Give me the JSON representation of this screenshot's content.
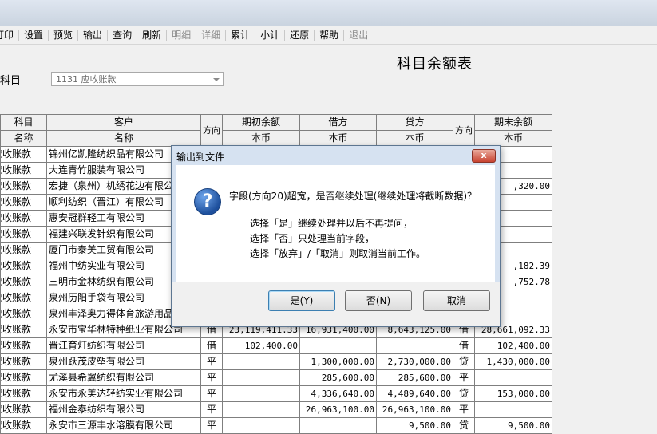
{
  "menu": [
    "打印",
    "设置",
    "预览",
    "输出",
    "查询",
    "刷新",
    "明细",
    "详细",
    "累计",
    "小计",
    "还原",
    "帮助",
    "退出"
  ],
  "menu_disabled": [
    "明细",
    "详细",
    "退出"
  ],
  "report_title": "科目余额表",
  "field_label": "科目",
  "combo_value": "1131 应收账款",
  "headers": {
    "row1": {
      "subject": "科目",
      "customer": "客户",
      "dir1": "方向",
      "opening": "期初余额",
      "debit": "借方",
      "credit": "贷方",
      "dir2": "方向",
      "closing": "期末余额"
    },
    "row2": {
      "subject": "名称",
      "customer": "名称",
      "opening": "本币",
      "debit": "本币",
      "credit": "本币",
      "closing": "本币"
    }
  },
  "rows": [
    [
      "应收账款",
      "锦州亿凯隆纺织品有限公司",
      "",
      "",
      "",
      "",
      "",
      ""
    ],
    [
      "应收账款",
      "大连青竹服装有限公司",
      "",
      "",
      "",
      "",
      "",
      ""
    ],
    [
      "应收账款",
      "宏捷（泉州）机绣花边有限公司",
      "",
      "",
      "",
      "",
      "",
      ",320.00"
    ],
    [
      "应收账款",
      "顺利纺织（晋江）有限公司",
      "",
      "",
      "",
      "",
      "",
      ""
    ],
    [
      "应收账款",
      "惠安冠群轻工有限公司",
      "",
      "",
      "",
      "",
      "",
      ""
    ],
    [
      "应收账款",
      "福建兴联发针织有限公司",
      "",
      "",
      "",
      "",
      "",
      ""
    ],
    [
      "应收账款",
      "厦门市泰美工贸有限公司",
      "",
      "",
      "",
      "",
      "",
      ""
    ],
    [
      "应收账款",
      "福州中纺实业有限公司",
      "",
      "",
      "",
      "",
      "",
      ",182.39"
    ],
    [
      "应收账款",
      "三明市金林纺织有限公司",
      "",
      "",
      "",
      "",
      "",
      ",752.78"
    ],
    [
      "应收账款",
      "泉州历阳手袋有限公司",
      "",
      "",
      "",
      "",
      "",
      ""
    ],
    [
      "应收账款",
      "泉州丰泽奥力得体育旅游用品",
      "",
      "",
      "",
      "",
      "",
      ""
    ],
    [
      "应收账款",
      "永安市宝华林特种纸业有限公司",
      "借",
      "23,119,411.33",
      "16,931,400.00",
      "8,643,125.00",
      "借",
      "28,661,092.33"
    ],
    [
      "应收账款",
      "晋江育灯纺织有限公司",
      "借",
      "102,400.00",
      "",
      "",
      "借",
      "102,400.00"
    ],
    [
      "应收账款",
      "泉州跃茂皮塑有限公司",
      "平",
      "",
      "1,300,000.00",
      "2,730,000.00",
      "贷",
      "1,430,000.00"
    ],
    [
      "应收账款",
      "尤溪县希翼纺织有限公司",
      "平",
      "",
      "285,600.00",
      "285,600.00",
      "平",
      ""
    ],
    [
      "应收账款",
      "永安市永美达轻纺实业有限公司",
      "平",
      "",
      "4,336,640.00",
      "4,489,640.00",
      "贷",
      "153,000.00"
    ],
    [
      "应收账款",
      "福州金泰纺织有限公司",
      "平",
      "",
      "26,963,100.00",
      "26,963,100.00",
      "平",
      ""
    ],
    [
      "应收账款",
      "永安市三源丰水溶膜有限公司",
      "平",
      "",
      "",
      "9,500.00",
      "贷",
      "9,500.00"
    ]
  ],
  "dialog": {
    "title": "输出到文件",
    "close_label": "x",
    "message": "字段(方向20)超宽，是否继续处理(继续处理将截断数据)？",
    "line2": "选择「是」继续处理并以后不再提问，",
    "line3": "选择「否」只处理当前字段，",
    "line4": "选择「放弃」/「取消」则取消当前工作。",
    "icon_glyph": "?",
    "yes_label": "是(Y)",
    "no_label": "否(N)",
    "cancel_label": "取消"
  }
}
